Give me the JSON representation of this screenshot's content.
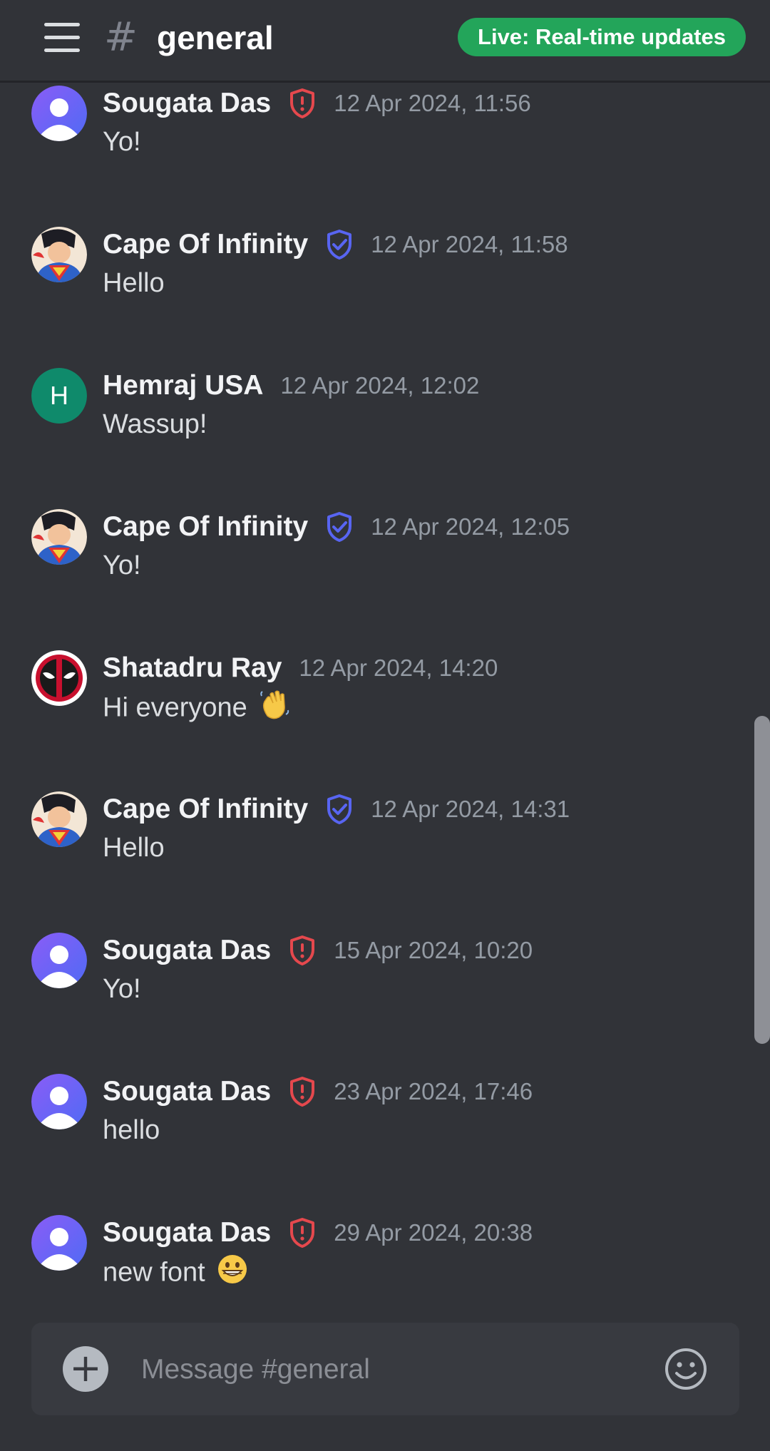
{
  "header": {
    "title": "general",
    "hash_symbol": "#",
    "live_badge": "Live: Real-time updates"
  },
  "colors": {
    "background": "#313338",
    "live_badge": "#23a55a",
    "admin_shield": "#e5484d",
    "verified_shield": "#5865f2",
    "avatar_gradient": [
      "#8a5cf6",
      "#4f6bf5"
    ],
    "hemraj_avatar": "#0f8a6b"
  },
  "messages": [
    {
      "author": "Sougata Das",
      "badge": "admin-shield-icon",
      "time": "12 Apr 2024, 11:56",
      "text": "Yo!",
      "avatar": "default-user-avatar"
    },
    {
      "author": "Cape Of Infinity",
      "badge": "verified-shield-icon",
      "time": "12 Apr 2024, 11:58",
      "text": "Hello",
      "avatar": "superman-avatar"
    },
    {
      "author": "Hemraj USA",
      "badge": "",
      "time": "12 Apr 2024, 12:02",
      "text": "Wassup!",
      "avatar": "letter-avatar",
      "avatar_letter": "H"
    },
    {
      "author": "Cape Of Infinity",
      "badge": "verified-shield-icon",
      "time": "12 Apr 2024, 12:05",
      "text": "Yo!",
      "avatar": "superman-avatar"
    },
    {
      "author": "Shatadru Ray",
      "badge": "",
      "time": "12 Apr 2024, 14:20",
      "text": "Hi everyone",
      "emoji": "waving-hand",
      "avatar": "deadpool-avatar"
    },
    {
      "author": "Cape Of Infinity",
      "badge": "verified-shield-icon",
      "time": "12 Apr 2024, 14:31",
      "text": "Hello",
      "avatar": "superman-avatar"
    },
    {
      "author": "Sougata Das",
      "badge": "admin-shield-icon",
      "time": "15 Apr 2024, 10:20",
      "text": "Yo!",
      "avatar": "default-user-avatar"
    },
    {
      "author": "Sougata Das",
      "badge": "admin-shield-icon",
      "time": "23 Apr 2024, 17:46",
      "text": "hello",
      "avatar": "default-user-avatar"
    },
    {
      "author": "Sougata Das",
      "badge": "admin-shield-icon",
      "time": "29 Apr 2024, 20:38",
      "text": "new font",
      "emoji": "grinning-face",
      "avatar": "default-user-avatar"
    }
  ],
  "composer": {
    "placeholder": "Message #general",
    "value": ""
  }
}
